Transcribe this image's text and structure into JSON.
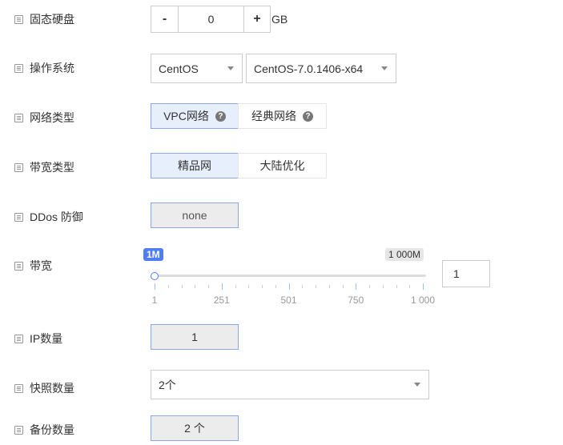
{
  "ssd": {
    "label": "固态硬盘",
    "minus": "-",
    "value": "0",
    "plus": "+",
    "unit": "GB"
  },
  "os": {
    "label": "操作系统",
    "type": "CentOS",
    "version": "CentOS-7.0.1406-x64"
  },
  "network": {
    "label": "网络类型",
    "options": [
      "VPC网络",
      "经典网络"
    ],
    "selected": "VPC网络",
    "help": "?"
  },
  "bandwidth_type": {
    "label": "带宽类型",
    "options": [
      "精品网",
      "大陆优化"
    ],
    "selected": "精品网"
  },
  "ddos": {
    "label": "DDos 防御",
    "value": "none"
  },
  "bandwidth": {
    "label": "带宽",
    "min_badge": "1M",
    "max_badge": "1 000M",
    "value": "1",
    "slider_value": 1,
    "slider_min": 1,
    "slider_max": 1000,
    "ticks": [
      "1",
      "251",
      "501",
      "750",
      "1 000"
    ]
  },
  "ip": {
    "label": "IP数量",
    "value": "1"
  },
  "snapshot": {
    "label": "快照数量",
    "value": "2个"
  },
  "backup": {
    "label": "备份数量",
    "value": "2 个"
  }
}
